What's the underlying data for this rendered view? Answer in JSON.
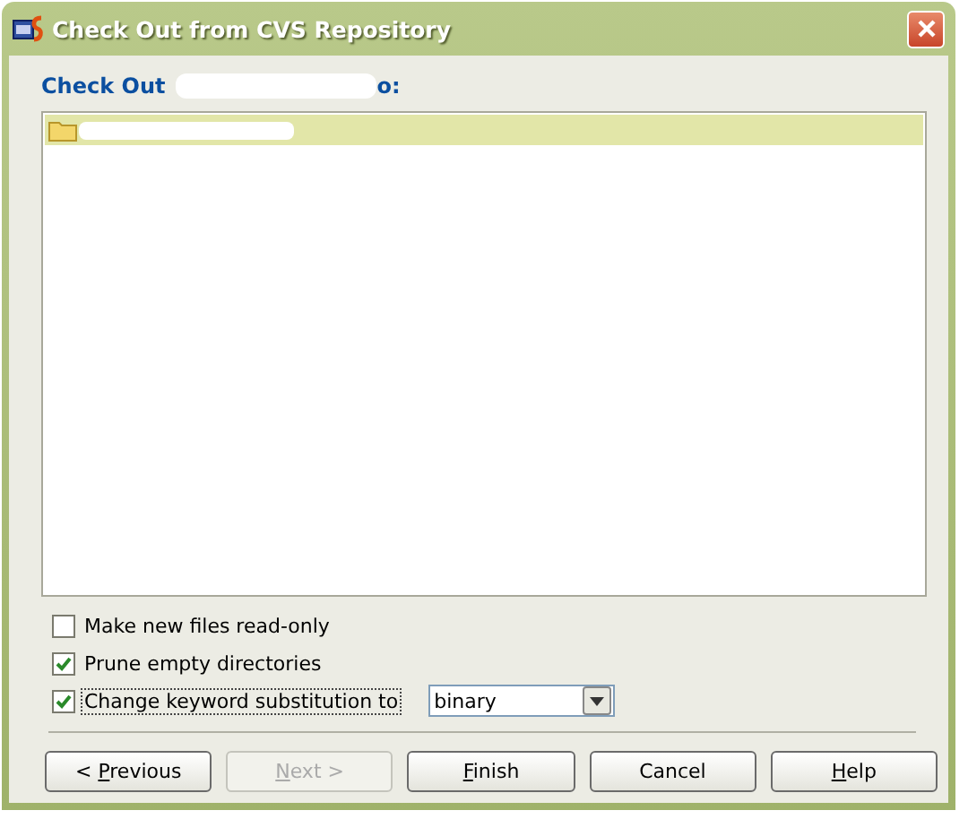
{
  "window": {
    "title": "Check Out from CVS Repository"
  },
  "heading": {
    "before": "Check Out",
    "after": "o:",
    "redacted": true
  },
  "tree": {
    "items": [
      {
        "kind": "folder",
        "selected": true,
        "redacted": true
      }
    ]
  },
  "options": [
    {
      "label": "Make new files read-only",
      "checked": false,
      "focused": false
    },
    {
      "label": "Prune empty directories",
      "checked": true,
      "focused": false
    },
    {
      "label": "Change keyword substitution to",
      "checked": true,
      "focused": true,
      "combo": {
        "value": "binary"
      }
    }
  ],
  "buttons": [
    {
      "before": "< ",
      "key": "P",
      "after": "revious",
      "disabled": false
    },
    {
      "key": "N",
      "after": "ext >",
      "disabled": true
    },
    {
      "key": "F",
      "after": "inish",
      "disabled": false
    },
    {
      "before": "Cancel",
      "disabled": false
    },
    {
      "key": "H",
      "after": "elp",
      "disabled": false
    }
  ]
}
